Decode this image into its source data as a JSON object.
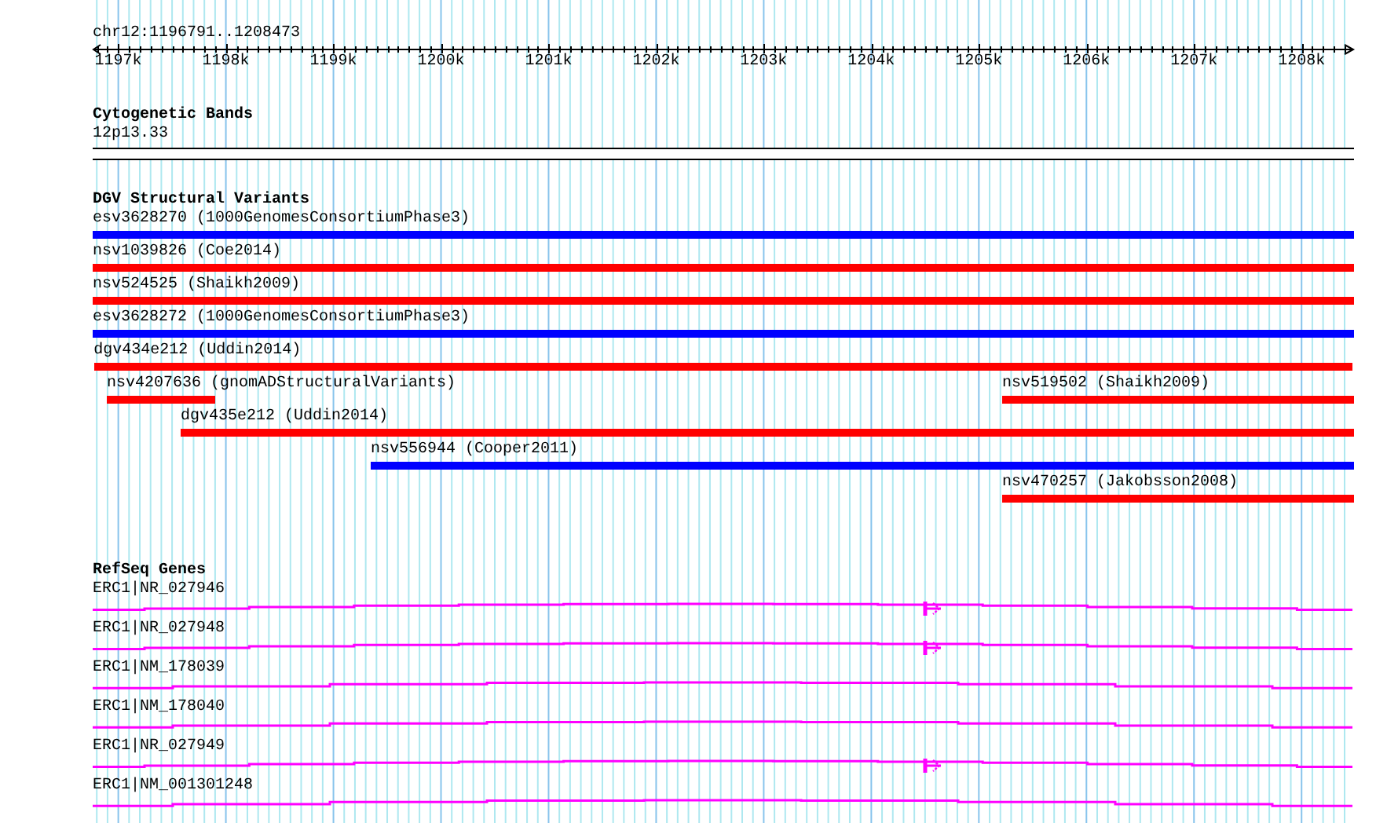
{
  "ruler": {
    "location": "chr12:1196791..1208473",
    "ticks": [
      {
        "label": "1197k"
      },
      {
        "label": "1198k"
      },
      {
        "label": "1199k"
      },
      {
        "label": "1200k"
      },
      {
        "label": "1201k"
      },
      {
        "label": "1202k"
      },
      {
        "label": "1203k"
      },
      {
        "label": "1204k"
      },
      {
        "label": "1205k"
      },
      {
        "label": "1206k"
      },
      {
        "label": "1207k"
      },
      {
        "label": "1208k"
      }
    ]
  },
  "tracks": [
    {
      "kind": "bands",
      "title": "Cytogenetic Bands",
      "bands": [
        {
          "name": "12p13.33"
        }
      ]
    },
    {
      "kind": "variants",
      "title": "DGV Structural Variants",
      "rows": [
        {
          "features": [
            {
              "label": "esv3628270 (1000GenomesConsortiumPhase3)",
              "color": "#0000ff"
            }
          ]
        },
        {
          "features": [
            {
              "label": "nsv1039826 (Coe2014)",
              "color": "#ff0000"
            }
          ]
        },
        {
          "features": [
            {
              "label": "nsv524525 (Shaikh2009)",
              "color": "#ff0000"
            }
          ]
        },
        {
          "features": [
            {
              "label": "esv3628272 (1000GenomesConsortiumPhase3)",
              "color": "#0000ff"
            }
          ]
        },
        {
          "features": [
            {
              "label": "dgv434e212 (Uddin2014)",
              "color": "#ff0000"
            }
          ]
        },
        {
          "features": [
            {
              "label": "nsv4207636 (gnomADStructuralVariants)",
              "color": "#ff0000"
            },
            {
              "label": "nsv519502 (Shaikh2009)",
              "color": "#ff0000"
            }
          ]
        },
        {
          "features": [
            {
              "label": "dgv435e212 (Uddin2014)",
              "color": "#ff0000"
            }
          ]
        },
        {
          "features": [
            {
              "label": "nsv556944 (Cooper2011)",
              "color": "#0000ff"
            }
          ]
        },
        {
          "features": [
            {
              "label": "nsv470257 (Jakobsson2008)",
              "color": "#ff0000"
            }
          ]
        }
      ]
    },
    {
      "kind": "genes",
      "title": "RefSeq Genes",
      "transcripts": [
        {
          "label": "ERC1|NR_027946",
          "kind": "narrow-steps",
          "start_marker": true
        },
        {
          "label": "ERC1|NR_027948",
          "kind": "narrow-steps",
          "start_marker": true
        },
        {
          "label": "ERC1|NM_178039",
          "kind": "wide-steps",
          "start_marker": false
        },
        {
          "label": "ERC1|NM_178040",
          "kind": "wide-steps",
          "start_marker": false
        },
        {
          "label": "ERC1|NR_027949",
          "kind": "narrow-steps",
          "start_marker": true
        },
        {
          "label": "ERC1|NM_001301248",
          "kind": "wide-steps",
          "start_marker": false
        }
      ]
    }
  ]
}
